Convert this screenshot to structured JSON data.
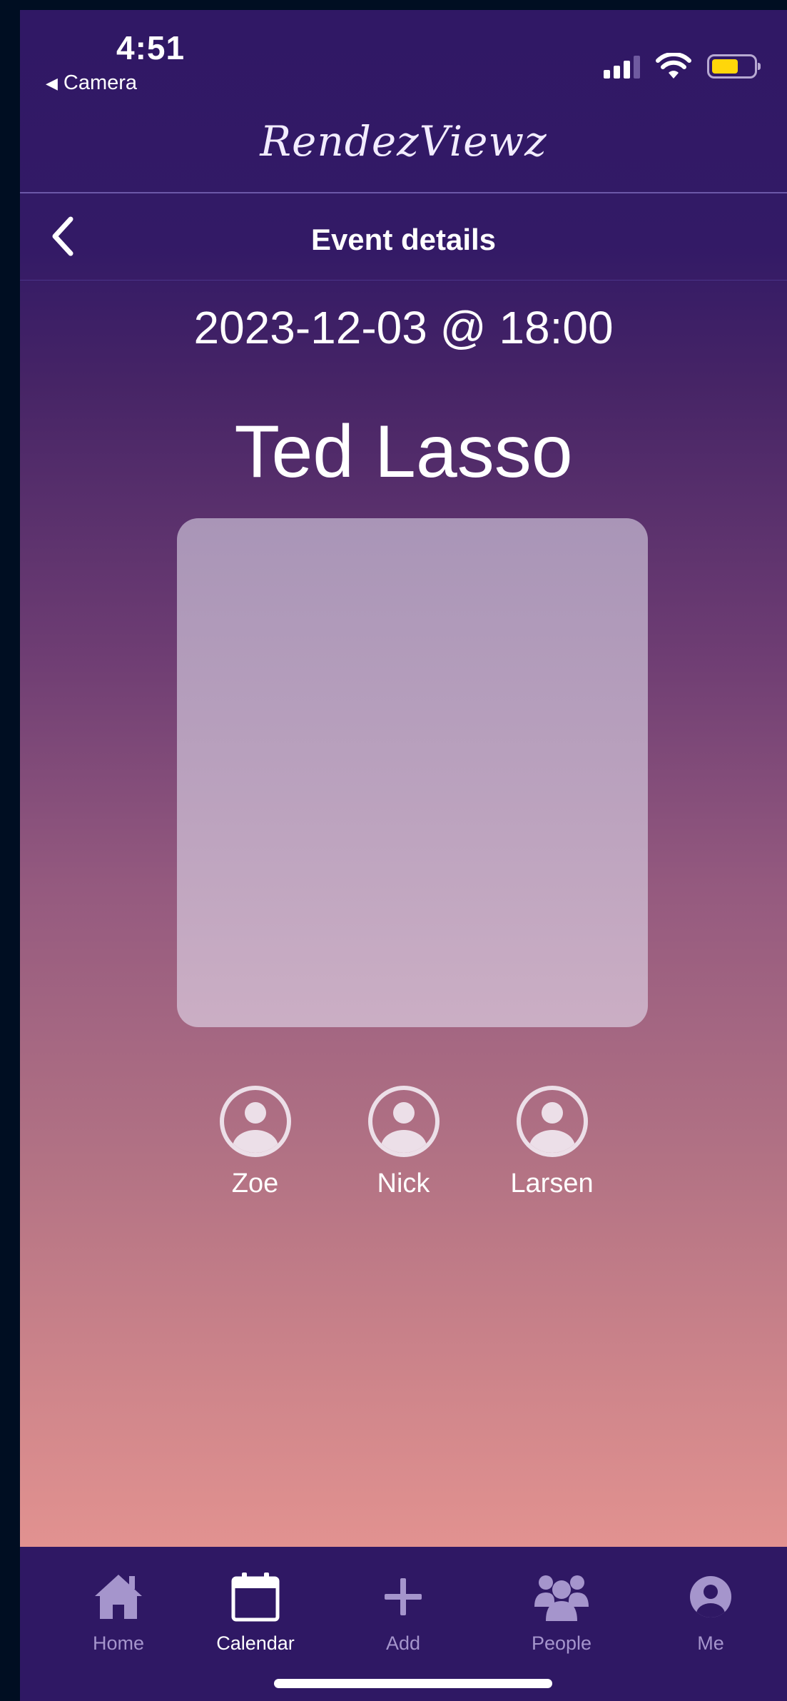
{
  "status_bar": {
    "time": "4:51",
    "back_app": "Camera"
  },
  "brand": {
    "name": "RendezViewz"
  },
  "header": {
    "title": "Event details"
  },
  "event": {
    "datetime": "2023-12-03 @ 18:00",
    "title": "Ted Lasso"
  },
  "attendees": [
    {
      "name": "Zoe",
      "icon": "user-circle-icon"
    },
    {
      "name": "Nick",
      "icon": "user-circle-icon"
    },
    {
      "name": "Larsen",
      "icon": "user-circle-icon"
    }
  ],
  "tab_bar": {
    "active": "Calendar",
    "items": [
      {
        "label": "Home",
        "icon": "home-icon"
      },
      {
        "label": "Calendar",
        "icon": "calendar-icon"
      },
      {
        "label": "Add",
        "icon": "plus-icon"
      },
      {
        "label": "People",
        "icon": "people-icon"
      },
      {
        "label": "Me",
        "icon": "user-icon"
      }
    ]
  },
  "colors": {
    "header_bg": "#301865",
    "gradient_bottom": "#e29290",
    "battery": "#ffd60a",
    "tab_inactive": "#a595cc"
  }
}
